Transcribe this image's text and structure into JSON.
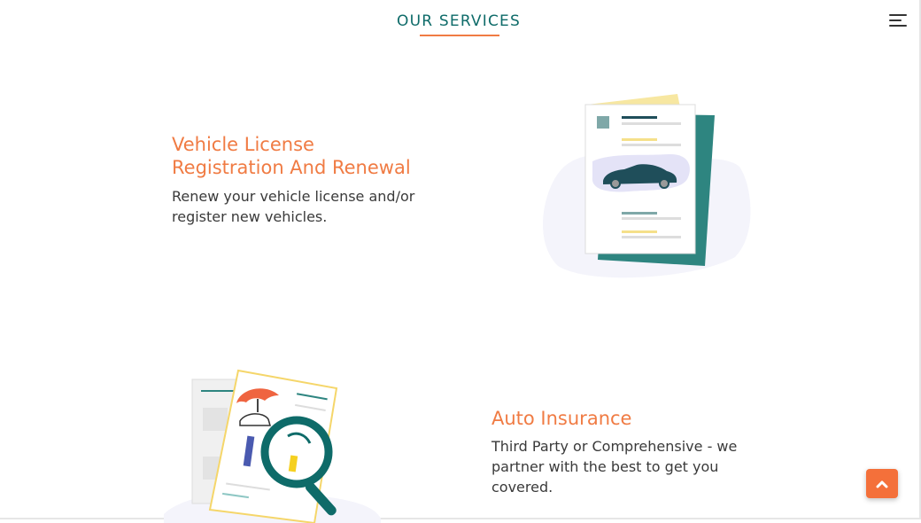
{
  "header": {
    "title": "OUR SERVICES",
    "menu_icon": "hamburger-menu-icon"
  },
  "services": [
    {
      "title_line1": "Vehicle License",
      "title_line2": "Registration And Renewal",
      "desc_line1": "Renew your vehicle license and/or",
      "desc_line2": "register new vehicles.",
      "illustration": "vehicle-documents-illustration"
    },
    {
      "title_line1": "Auto Insurance",
      "desc_line1": "Third Party or Comprehensive - we",
      "desc_line2": "partner with the best to get you",
      "desc_line3": "covered.",
      "illustration": "insurance-search-illustration"
    }
  ],
  "scroll_top": {
    "icon": "chevron-up-icon"
  },
  "colors": {
    "accent": "#f07b43",
    "teal": "#0e6b69",
    "scroll_button": "#f4703a"
  }
}
